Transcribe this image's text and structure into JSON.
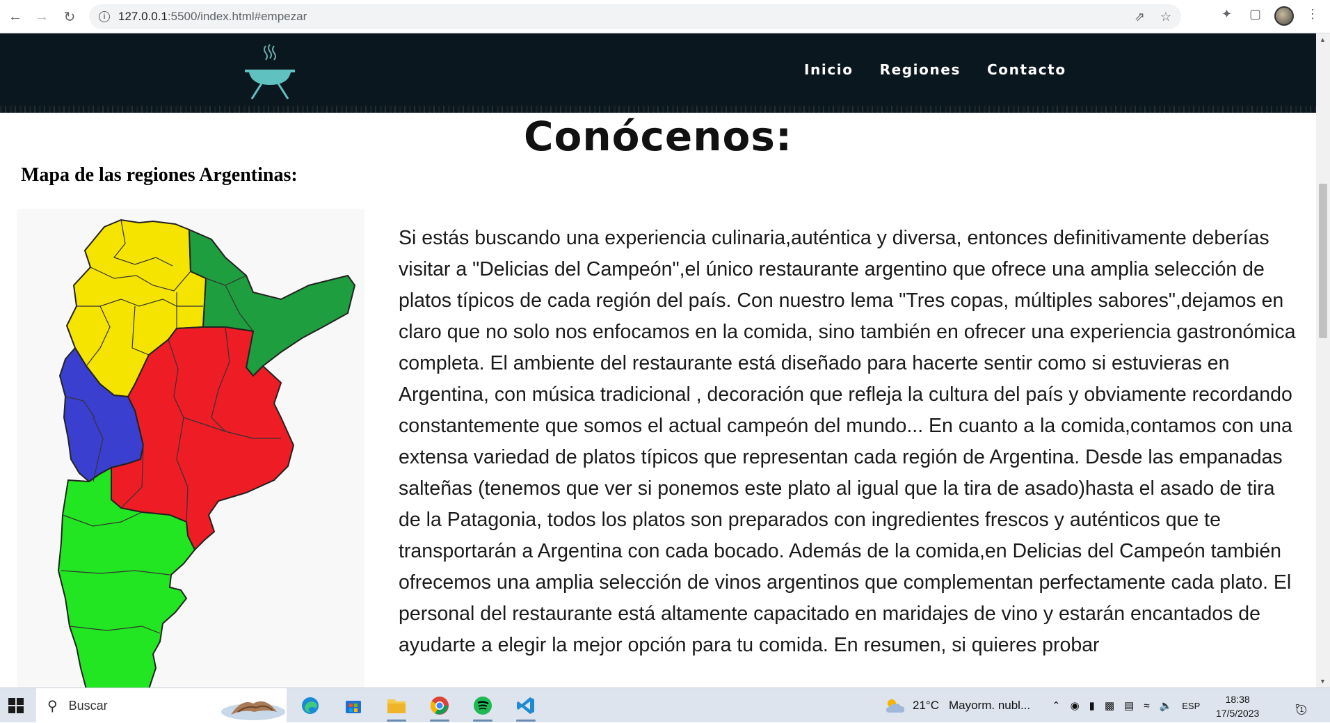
{
  "browser": {
    "url_host": "127.0.0.1",
    "url_rest": ":5500/index.html#empezar"
  },
  "site": {
    "nav": [
      "Inicio",
      "Regiones",
      "Contacto"
    ]
  },
  "main": {
    "title": "Conócenos:",
    "map_heading": "Mapa de las regiones Argentinas:",
    "about_text": "Si estás buscando una experiencia culinaria,auténtica y diversa, entonces definitivamente deberías visitar a \"Delicias del Campeón\",el único restaurante argentino que ofrece una amplia selección de platos típicos de cada región del país. Con nuestro lema \"Tres copas, múltiples sabores\",dejamos en claro que no solo nos enfocamos en la comida, sino también en ofrecer una experiencia gastronómica completa. El ambiente del restaurante está diseñado para hacerte sentir como si estuvieras en Argentina, con música tradicional , decoración que refleja la cultura del país y obviamente recordando constantemente que somos el actual campeón del mundo... En cuanto a la comida,contamos con una extensa variedad de platos típicos que representan cada región de Argentina. Desde las empanadas salteñas (tenemos que ver si ponemos este plato al igual que la tira de asado)hasta el asado de tira de la Patagonia, todos los platos son preparados con ingredientes frescos y auténticos que te transportarán a Argentina con cada bocado. Además de la comida,en Delicias del Campeón también ofrecemos una amplia selección de vinos argentinos que complementan perfectamente cada plato. El personal del restaurante está altamente capacitado en maridajes de vino y estarán encantados de ayudarte a elegir la mejor opción para tu comida. En resumen, si quieres probar"
  },
  "map_colors": {
    "noa": "#f5e400",
    "nea": "#1e9e3e",
    "cuyo": "#3a3fd0",
    "pampeana": "#ee1c25",
    "patagonia": "#22e622"
  },
  "taskbar": {
    "search_label": "Buscar",
    "weather": "21°C",
    "weather_desc": "Mayorm. nubl...",
    "language": "ESP",
    "time": "18:38",
    "date": "17/5/2023",
    "notification_count": "1"
  }
}
